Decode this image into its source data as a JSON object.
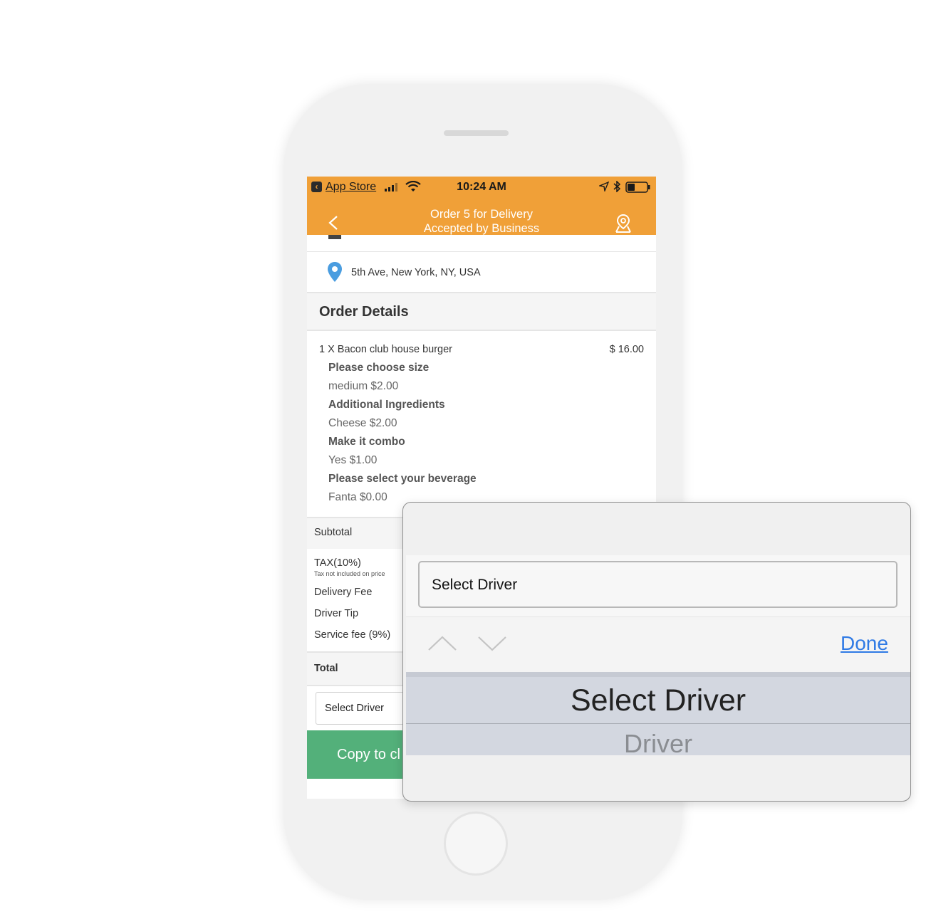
{
  "status_bar": {
    "back_app": "App Store",
    "time": "10:24 AM"
  },
  "nav": {
    "title_line1": "Order 5 for Delivery",
    "title_line2": "Accepted by Business"
  },
  "address": "5th Ave, New York, NY, USA",
  "order_details": {
    "title": "Order Details",
    "item": "1 X Bacon club house burger",
    "price": "$ 16.00",
    "options": [
      {
        "heading": "Please choose size",
        "value": "medium $2.00"
      },
      {
        "heading": "Additional Ingredients",
        "value": "Cheese $2.00"
      },
      {
        "heading": "Make it combo",
        "value": "Yes $1.00"
      },
      {
        "heading": "Please select your beverage",
        "value": "Fanta $0.00"
      }
    ]
  },
  "totals": {
    "subtotal": "Subtotal",
    "tax": "TAX(10%)",
    "tax_note": "Tax not included on price",
    "delivery_fee": "Delivery Fee",
    "driver_tip": "Driver Tip",
    "service_fee": "Service fee (9%)",
    "total": "Total"
  },
  "select_driver": "Select Driver",
  "copy_button": "Copy to cl",
  "popup": {
    "input_value": "Select Driver",
    "done": "Done",
    "picker_options": [
      "Select Driver",
      "Driver"
    ]
  },
  "colors": {
    "header": "#f0a038",
    "copy_button": "#53b07a",
    "done": "#2f7ae5"
  }
}
